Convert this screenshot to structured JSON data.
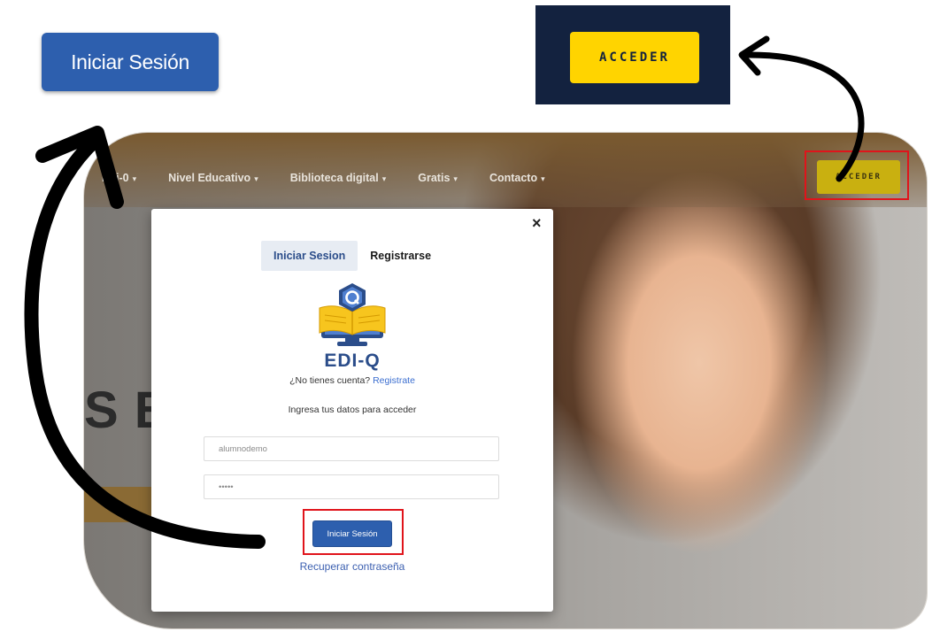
{
  "callouts": {
    "login_button_label": "Iniciar Sesión",
    "acceder_button_label": "ACCEDER"
  },
  "site": {
    "nav": [
      {
        "label": "Edi-0",
        "caret": "▾"
      },
      {
        "label": "Nivel Educativo",
        "caret": "▾"
      },
      {
        "label": "Biblioteca digital",
        "caret": "▾"
      },
      {
        "label": "Gratis",
        "caret": "▾"
      },
      {
        "label": "Contacto",
        "caret": "▾"
      }
    ],
    "acceder_label": "ACCEDER",
    "hero_text": "S BI"
  },
  "modal": {
    "close_label": "×",
    "tabs": [
      {
        "label": "Iniciar Sesion",
        "active": true
      },
      {
        "label": "Registrarse",
        "active": false
      }
    ],
    "brand": "EDI-Q",
    "signup_prompt": "¿No tienes cuenta?",
    "signup_link": "Registrate",
    "instructions": "Ingresa tus datos para acceder",
    "username_value": "alumnodemo",
    "password_value": "•••••",
    "submit_label": "Iniciar Sesión",
    "recover_label": "Recuperar contraseña"
  },
  "colors": {
    "primary_blue": "#2d5fae",
    "accent_yellow": "#ffd400",
    "dark_navy": "#13223f",
    "highlight_red": "#e0141b"
  }
}
